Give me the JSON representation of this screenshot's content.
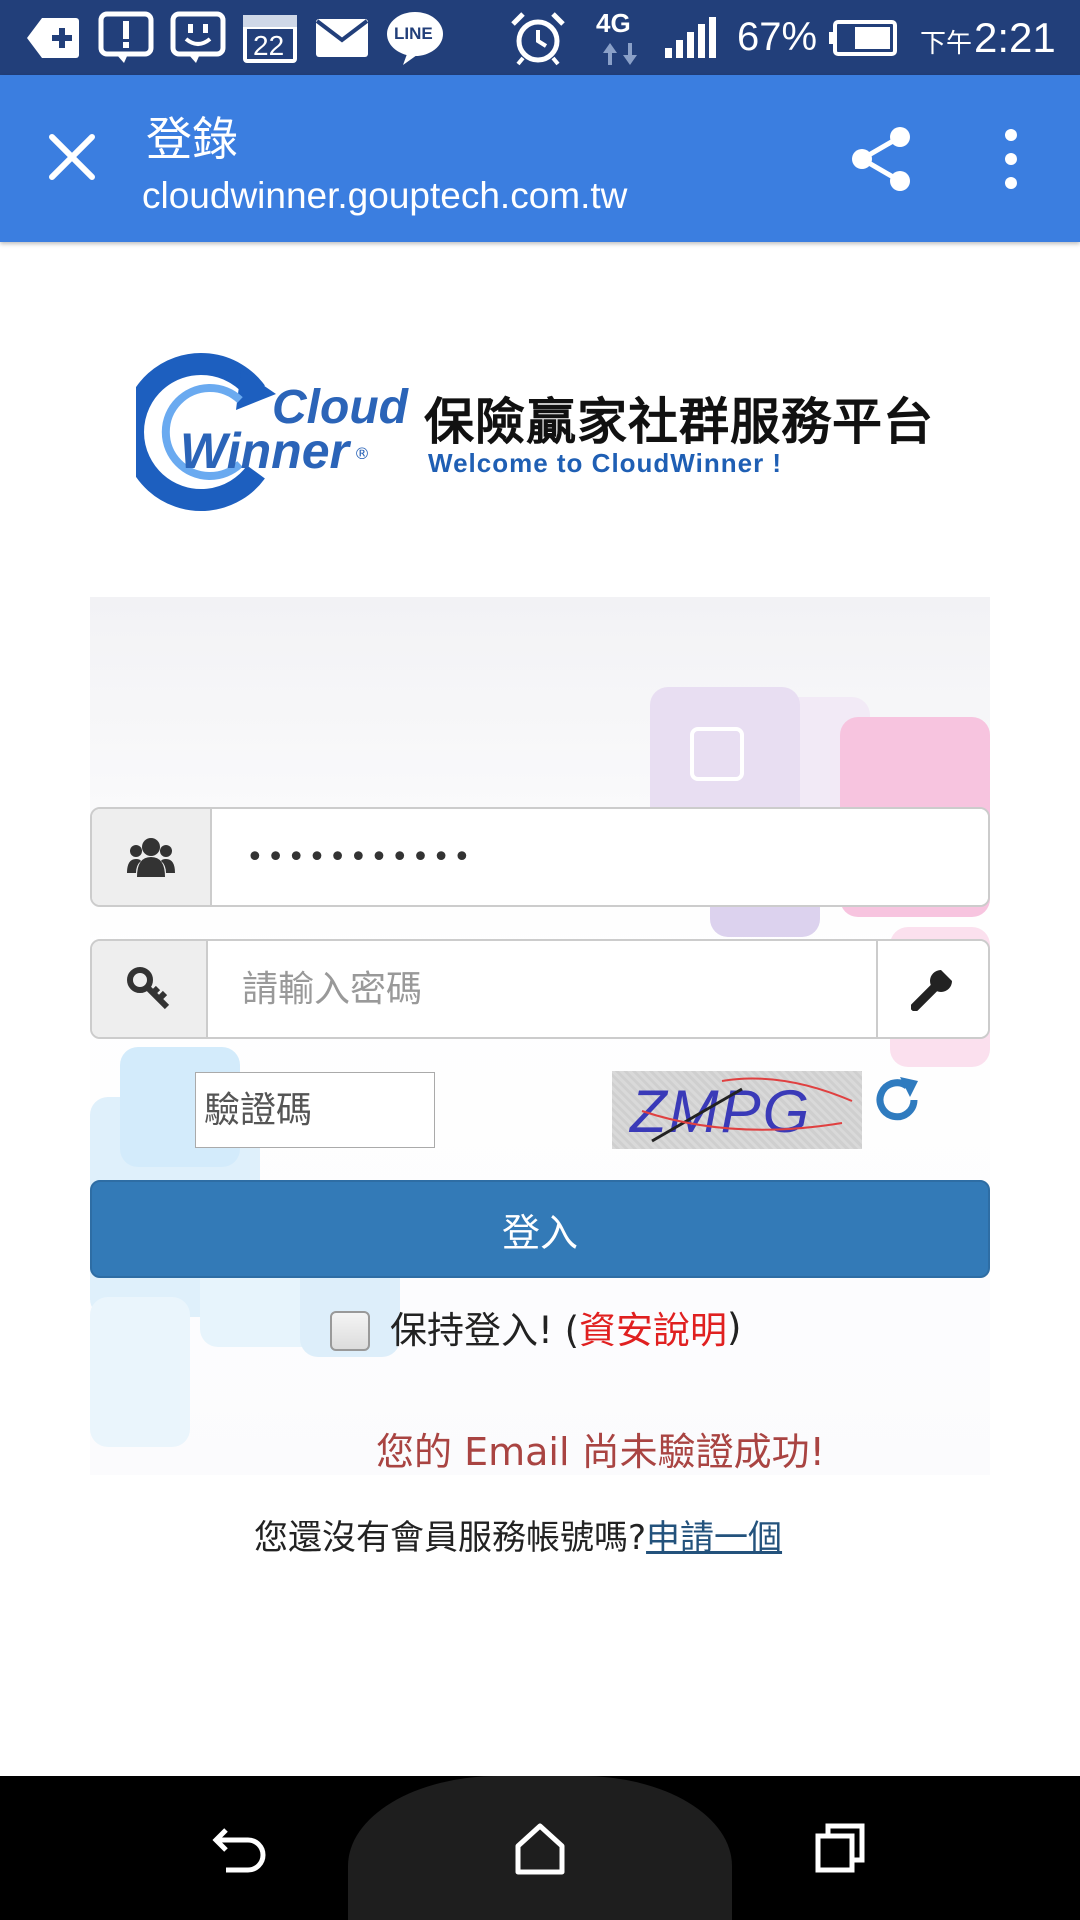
{
  "status_bar": {
    "calendar_day": "22",
    "line_label": "LINE",
    "network": "4G",
    "battery": "67%",
    "time_prefix": "下午",
    "time": "2:21"
  },
  "toolbar": {
    "title": "登錄",
    "url": "cloudwinner.gouptech.com.tw"
  },
  "logo": {
    "cloud": "Cloud",
    "winner": "Winner",
    "registered": "®",
    "heading": "保險贏家社群服務平台",
    "welcome": "Welcome to CloudWinner !"
  },
  "form": {
    "username_value": "•••••••••••",
    "password_placeholder": "請輸入密碼",
    "captcha_placeholder": "驗證碼",
    "captcha_text": "ZMPG",
    "login_label": "登入",
    "remember_label": "保持登入! (",
    "security_link": "資安說明",
    "remember_suffix": ")",
    "error_message": "您的 Email 尚未驗證成功!"
  },
  "signup": {
    "prompt": "您還沒有會員服務帳號嗎?",
    "link": "申請一個"
  },
  "colors": {
    "status_bar": "#223f7a",
    "toolbar": "#3b7ee0",
    "primary_button": "#337ab7",
    "error": "#a94442",
    "link_red": "#e02020"
  }
}
